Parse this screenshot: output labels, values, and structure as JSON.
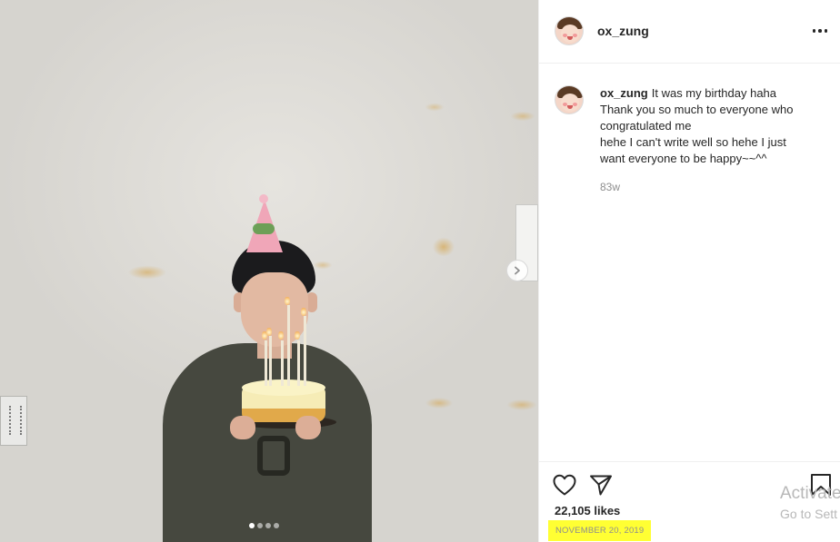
{
  "post": {
    "username": "ox_zung",
    "caption": {
      "username": "ox_zung",
      "lines": [
        "It was my birthday haha",
        "Thank you so much to everyone who",
        "congratulated me",
        "hehe I can't write well so hehe I just",
        "want everyone to be happy~~^^"
      ]
    },
    "time_ago": "83w",
    "likes": "22,105 likes",
    "date": "NOVEMBER 20, 2019",
    "carousel": {
      "count": 4,
      "active_index": 0
    }
  },
  "icons": {
    "more": "more-options-icon",
    "next": "chevron-right-icon",
    "like": "heart-outline-icon",
    "share": "paper-plane-icon",
    "save": "bookmark-outline-icon"
  },
  "colors": {
    "highlight": "#ffff33",
    "text": "#262626",
    "muted": "#8e8e8e"
  },
  "watermark": {
    "line1": "Activate",
    "line2": "Go to Sett"
  }
}
